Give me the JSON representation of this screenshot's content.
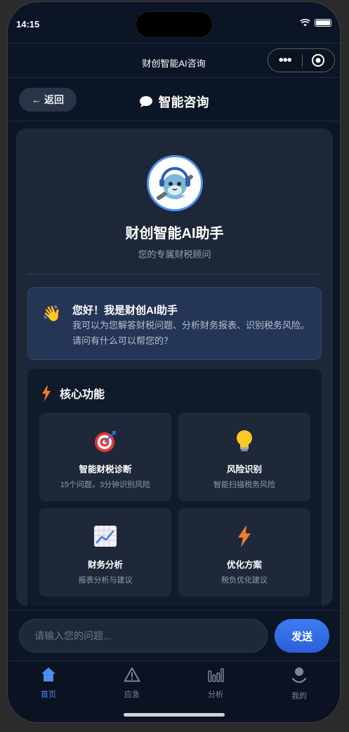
{
  "status_bar": {
    "time": "14:15"
  },
  "navbar": {
    "title": "财创智能AI咨询",
    "menu_dots": "•••"
  },
  "header": {
    "back_label": "返回",
    "back_arrow": "←",
    "title": "智能咨询",
    "title_icon": "chat-bubble-icon"
  },
  "assistant": {
    "name": "财创智能AI助手",
    "subtitle": "您的专属财税顾问",
    "avatar_icon": "robot-mascot-icon"
  },
  "greeting": {
    "emoji": "👋",
    "title": "您好！我是财创AI助手",
    "text": "我可以为您解答财税问题、分析财务报表、识别税务风险。请问有什么可以帮您的？"
  },
  "features": {
    "title": "核心功能",
    "title_icon": "lightning-icon",
    "items": [
      {
        "icon": "target-icon",
        "emoji": "🎯",
        "title": "智能财税诊断",
        "desc": "15个问题，3分钟识别风险"
      },
      {
        "icon": "lightbulb-icon",
        "emoji": "💡",
        "title": "风险识别",
        "desc": "智能扫描税务风险"
      },
      {
        "icon": "chart-icon",
        "emoji": "📈",
        "title": "财务分析",
        "desc": "报表分析与建议"
      },
      {
        "icon": "lightning-icon",
        "emoji": "⚡",
        "title": "优化方案",
        "desc": "税负优化建议"
      }
    ]
  },
  "input": {
    "placeholder": "请输入您的问题...",
    "send_label": "发送"
  },
  "tabs": [
    {
      "label": "首页",
      "icon": "home-icon",
      "active": true
    },
    {
      "label": "应急",
      "icon": "warning-icon",
      "active": false
    },
    {
      "label": "分析",
      "icon": "bar-chart-icon",
      "active": false
    },
    {
      "label": "我的",
      "icon": "user-icon",
      "active": false
    }
  ],
  "colors": {
    "accent": "#4d8ef0",
    "background": "#0c1526",
    "card": "#1d2738",
    "lightning": "#f07b2a"
  }
}
